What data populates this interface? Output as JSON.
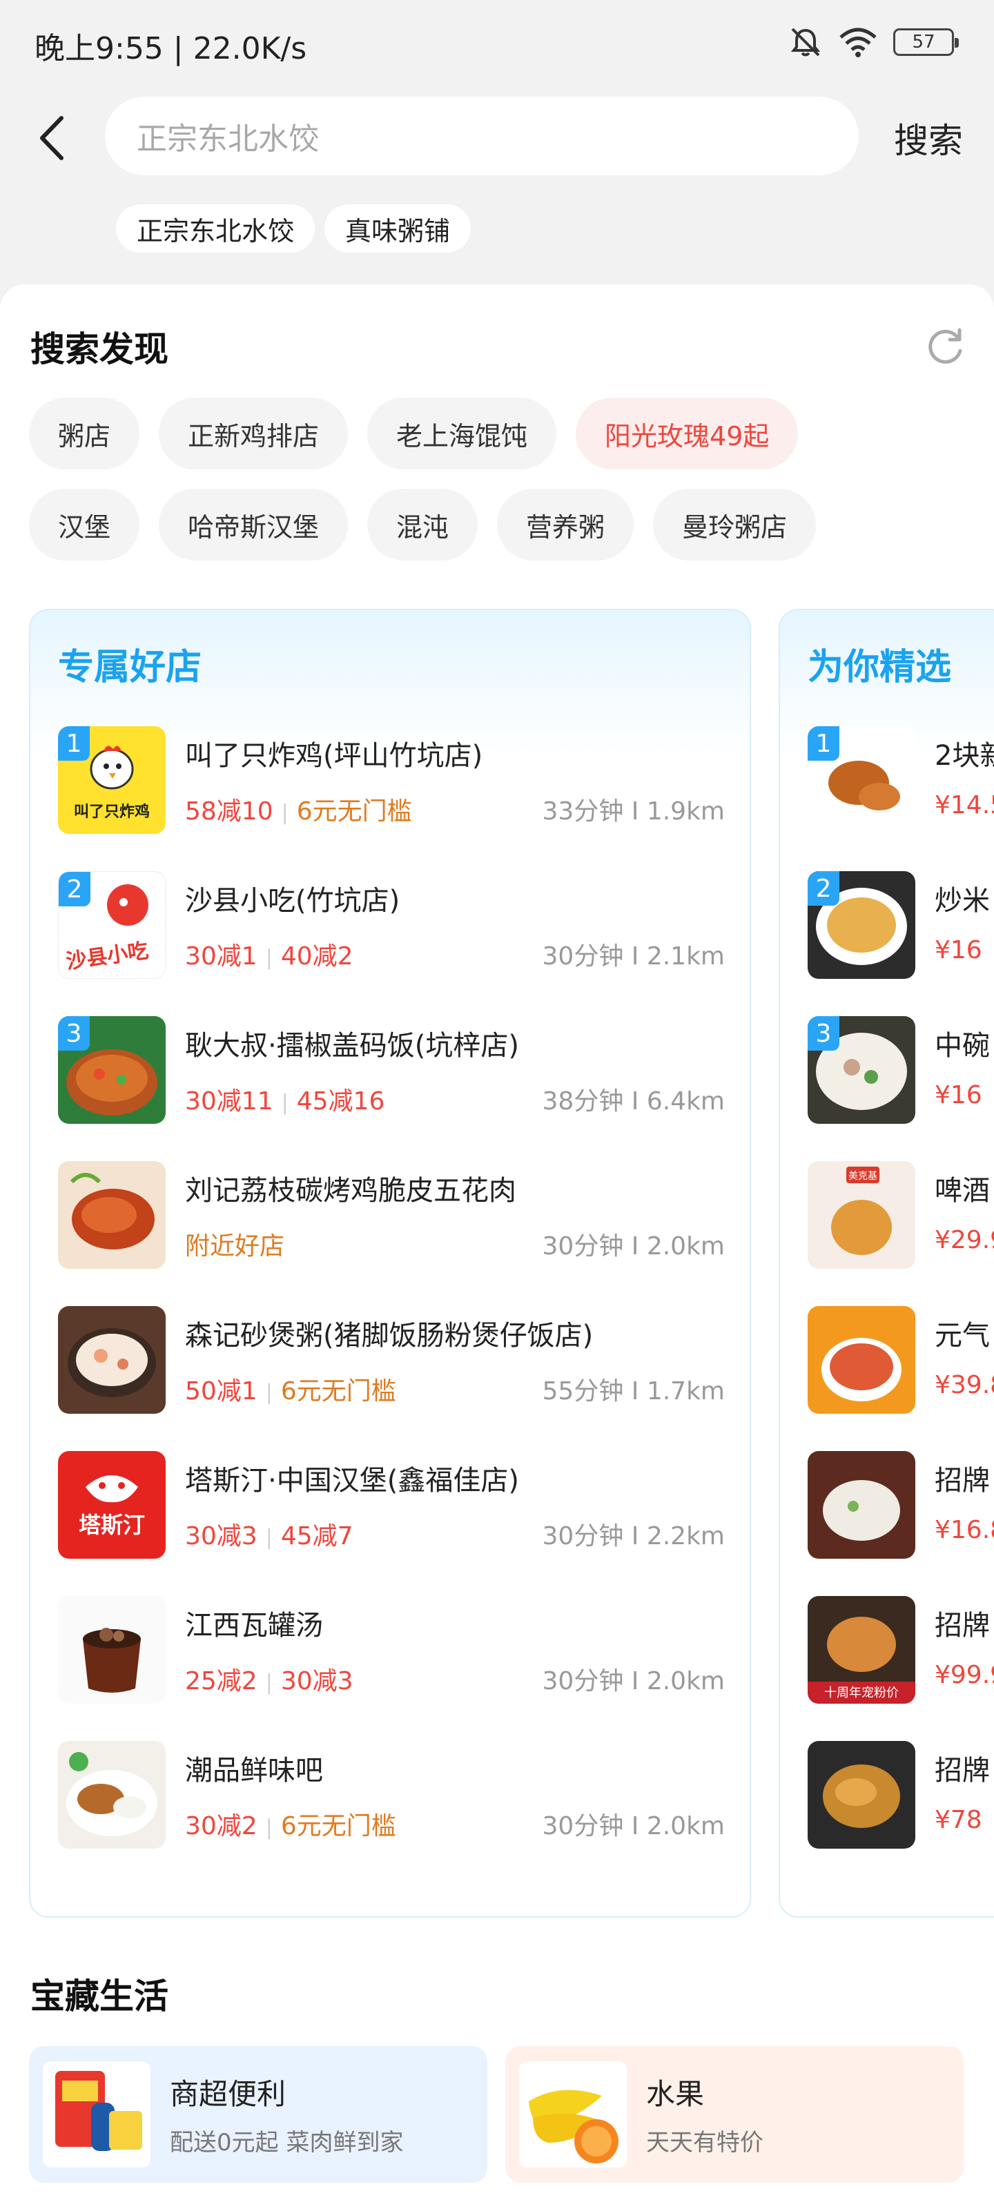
{
  "status": {
    "time_speed": "晚上9:55 | 22.0K/s",
    "battery": "57"
  },
  "search": {
    "placeholder": "正宗东北水饺",
    "button": "搜索"
  },
  "history": [
    "正宗东北水饺",
    "真味粥铺"
  ],
  "discover": {
    "title": "搜索发现",
    "row1": [
      "粥店",
      "正新鸡排店",
      "老上海馄饨",
      "阳光玫瑰49起"
    ],
    "row2": [
      "汉堡",
      "哈帝斯汉堡",
      "混沌",
      "营养粥",
      "曼玲粥店"
    ]
  },
  "exclusive": {
    "title": "专属好店",
    "items": [
      {
        "rank": "1",
        "name": "叫了只炸鸡(坪山竹坑店)",
        "promo1": "58减10",
        "promo2": "6元无门槛",
        "meta": "33分钟 I 1.9km",
        "thumb_text": "叫了只炸鸡"
      },
      {
        "rank": "2",
        "name": "沙县小吃(竹坑店)",
        "promo1": "30减1",
        "promo2": "40减2",
        "meta": "30分钟 I 2.1km",
        "thumb_text": "沙县小吃"
      },
      {
        "rank": "3",
        "name": "耿大叔·擂椒盖码饭(坑梓店)",
        "promo1": "30减11",
        "promo2": "45减16",
        "meta": "38分钟 I 6.4km"
      },
      {
        "name": "刘记荔枝碳烤鸡脆皮五花肉",
        "promo1": "附近好店",
        "meta": "30分钟 I 2.0km"
      },
      {
        "name": "森记砂煲粥(猪脚饭肠粉煲仔饭店)",
        "promo1": "50减1",
        "promo2": "6元无门槛",
        "meta": "55分钟 I 1.7km"
      },
      {
        "name": "塔斯汀·中国汉堡(鑫福佳店)",
        "promo1": "30减3",
        "promo2": "45减7",
        "meta": "30分钟 I 2.2km",
        "thumb_text": "塔斯汀"
      },
      {
        "name": "江西瓦罐汤",
        "promo1": "25减2",
        "promo2": "30减3",
        "meta": "30分钟 I 2.0km"
      },
      {
        "name": "潮品鲜味吧",
        "promo1": "30减2",
        "promo2": "6元无门槛",
        "meta": "30分钟 I 2.0km"
      }
    ]
  },
  "picks": {
    "title": "为你精选",
    "items": [
      {
        "rank": "1",
        "name": "2块新",
        "price": "¥14.5"
      },
      {
        "rank": "2",
        "name": "炒米",
        "price": "¥16"
      },
      {
        "rank": "3",
        "name": "中碗",
        "price": "¥16"
      },
      {
        "name": "啤酒",
        "price": "¥29.9",
        "thumb_text": "美克基"
      },
      {
        "name": "元气",
        "price": "¥39.8"
      },
      {
        "name": "招牌",
        "price": "¥16.8"
      },
      {
        "name": "招牌",
        "price": "¥99.9",
        "thumb_text": "十周年宠粉价"
      },
      {
        "name": "招牌",
        "price": "¥78"
      }
    ]
  },
  "life": {
    "title": "宝藏生活",
    "items": [
      {
        "title": "商超便利",
        "sub": "配送0元起 菜肉鲜到家"
      },
      {
        "title": "水果",
        "sub": "天天有特价"
      }
    ]
  },
  "colors": {
    "accent_blue": "#1aa3ee",
    "promo_red": "#f0463c",
    "promo_orange": "#e07a1f"
  }
}
